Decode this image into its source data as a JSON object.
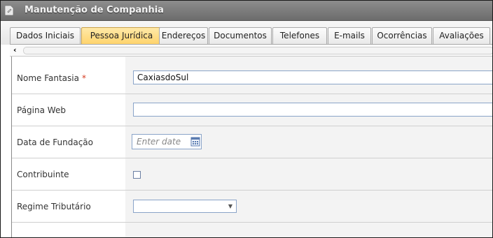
{
  "window": {
    "title": "Manutenção de Companhia",
    "icon": "document-edit-icon"
  },
  "tabs": [
    {
      "label": "Dados Iniciais",
      "active": false
    },
    {
      "label": "Pessoa Jurídica",
      "active": true
    },
    {
      "label": "Endereços",
      "active": false
    },
    {
      "label": "Documentos",
      "active": false
    },
    {
      "label": "Telefones",
      "active": false
    },
    {
      "label": "E-mails",
      "active": false
    },
    {
      "label": "Ocorrências",
      "active": false
    },
    {
      "label": "Avaliações",
      "active": false
    }
  ],
  "scroll": {
    "left_arrow": "‹",
    "icon": "chevron-left-icon"
  },
  "form": {
    "nome_fantasia": {
      "label": "Nome Fantasia",
      "required_mark": "*",
      "value": "CaxiasdoSul"
    },
    "pagina_web": {
      "label": "Página Web",
      "value": ""
    },
    "data_fundacao": {
      "label": "Data de Fundação",
      "placeholder": "Enter date",
      "icon": "calendar-icon"
    },
    "contribuinte": {
      "label": "Contribuinte",
      "checked": false
    },
    "regime_tributario": {
      "label": "Regime Tributário",
      "value": "",
      "icon": "chevron-down-icon",
      "arrow": "▼"
    }
  },
  "colors": {
    "active_tab": "#ffd36a",
    "titlebar": "#7a7a7a",
    "required": "#d63a1f",
    "input_border": "#8aa4c8"
  }
}
